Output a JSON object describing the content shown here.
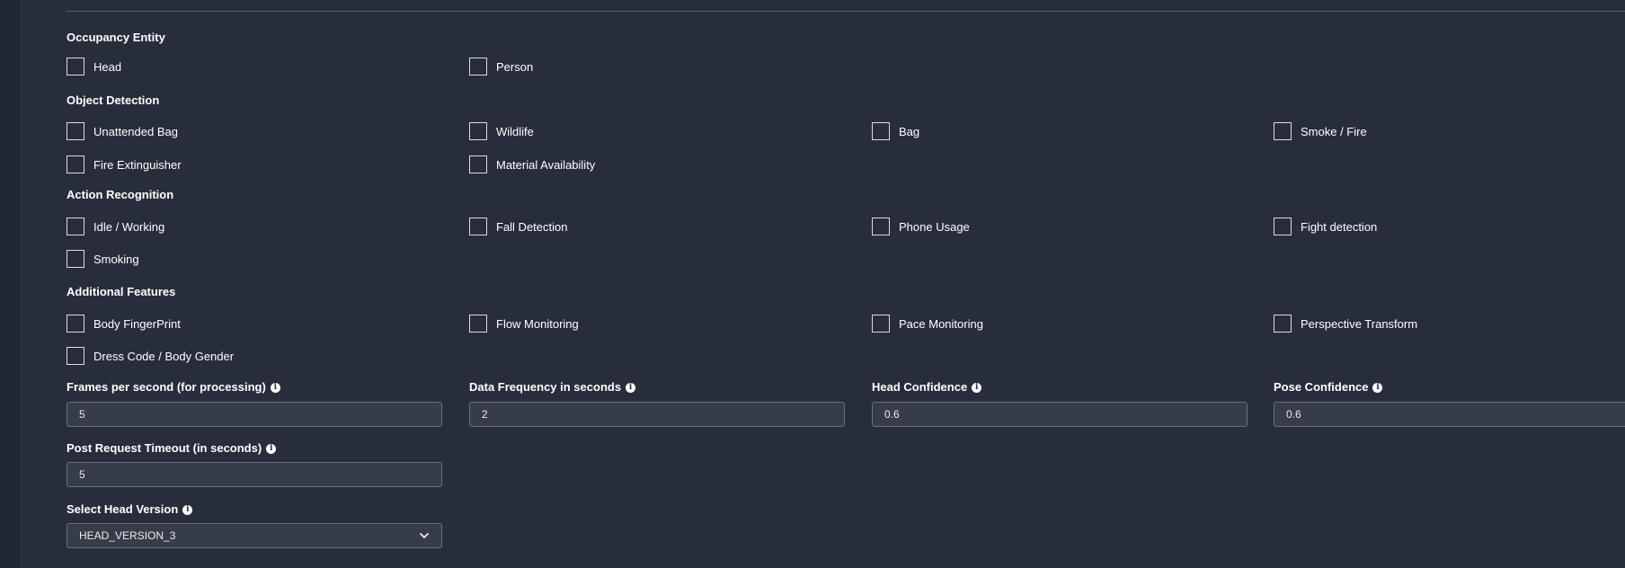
{
  "sections": {
    "occupancy": {
      "title": "Occupancy Entity",
      "items": [
        "Head",
        "Person"
      ]
    },
    "object_detection": {
      "title": "Object Detection",
      "items": [
        "Unattended Bag",
        "Wildlife",
        "Bag",
        "Smoke / Fire",
        "Fire Extinguisher",
        "Material Availability"
      ]
    },
    "action_recognition": {
      "title": "Action Recognition",
      "items": [
        "Idle / Working",
        "Fall Detection",
        "Phone Usage",
        "Fight detection",
        "Smoking"
      ]
    },
    "additional_features": {
      "title": "Additional Features",
      "items": [
        "Body FingerPrint",
        "Flow Monitoring",
        "Pace Monitoring",
        "Perspective Transform",
        "Dress Code / Body Gender"
      ]
    }
  },
  "fields": {
    "fps": {
      "label": "Frames per second (for processing)",
      "value": "5"
    },
    "data_frequency": {
      "label": "Data Frequency in seconds",
      "value": "2"
    },
    "head_confidence": {
      "label": "Head Confidence",
      "value": "0.6"
    },
    "pose_confidence": {
      "label": "Pose Confidence",
      "value": "0.6"
    },
    "post_timeout": {
      "label": "Post Request Timeout (in seconds)",
      "value": "5"
    },
    "head_version": {
      "label": "Select Head Version",
      "value": "HEAD_VERSION_3"
    }
  },
  "icons": {
    "info": "info-icon",
    "dropdown": "chevron-down-icon"
  },
  "colors": {
    "panel_bg": "#272d3b",
    "input_bg": "#373d48",
    "text": "#ffffff"
  }
}
